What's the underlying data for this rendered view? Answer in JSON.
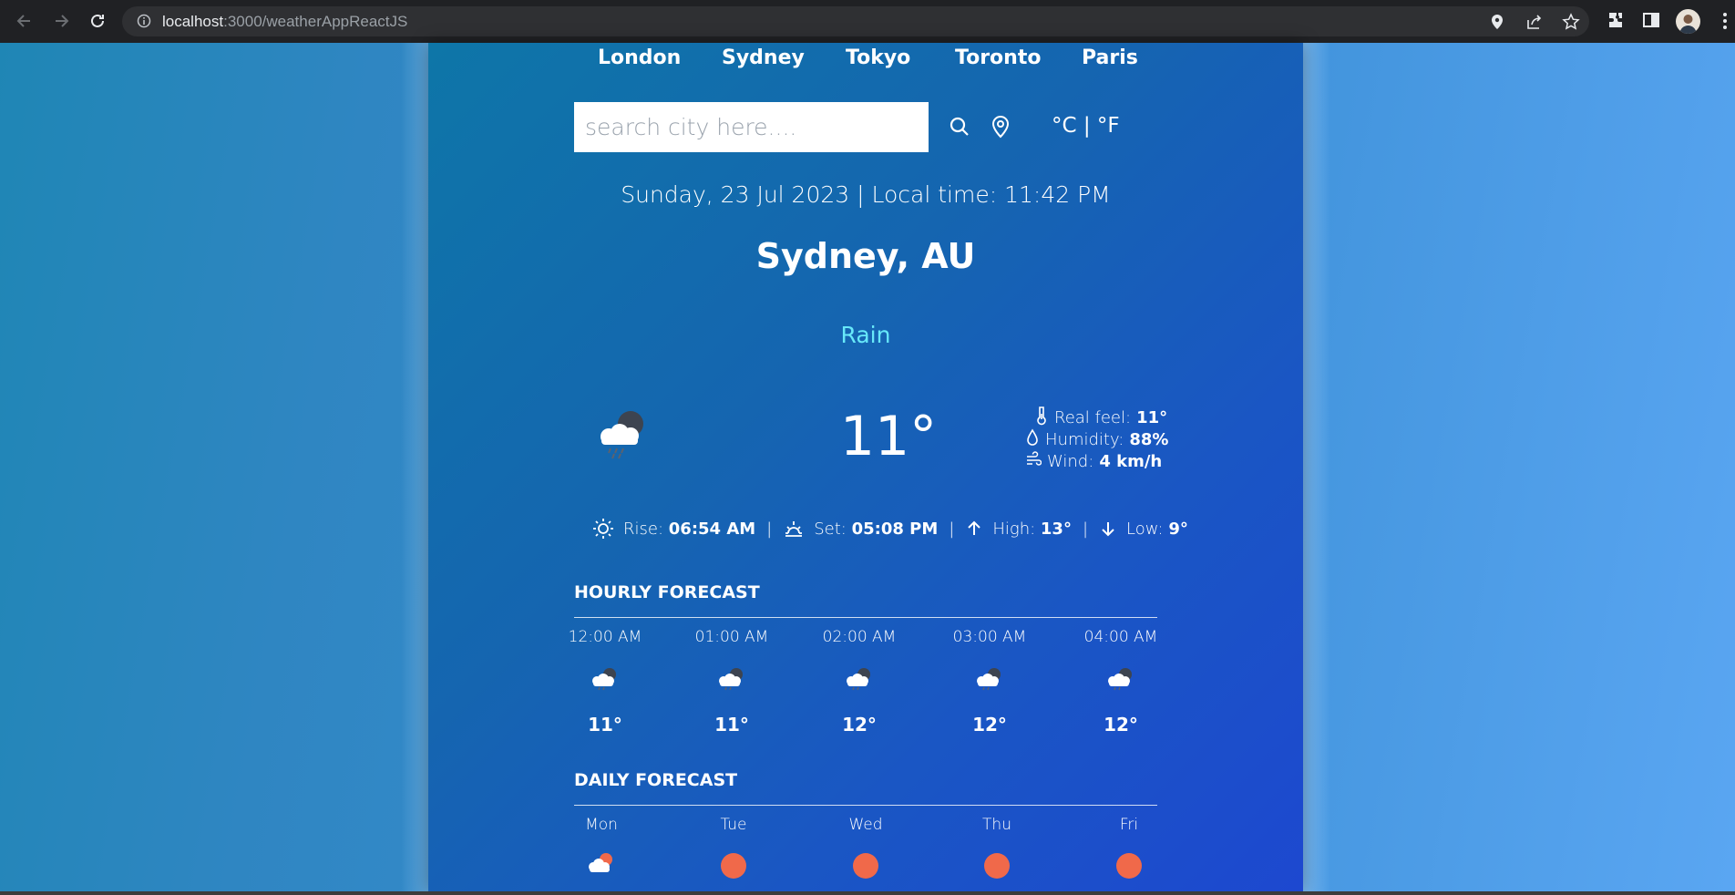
{
  "browser": {
    "url_host": "localhost",
    "url_path": ":3000/weatherAppReactJS"
  },
  "cities": [
    "London",
    "Sydney",
    "Tokyo",
    "Toronto",
    "Paris"
  ],
  "search": {
    "placeholder": "search city here...."
  },
  "units": {
    "label": "°C | °F"
  },
  "datetime": "Sunday, 23 Jul 2023 | Local time: 11:42 PM",
  "location": "Sydney, AU",
  "condition": "Rain",
  "temperature": "11°",
  "details": {
    "real_feel_label": "Real feel:",
    "real_feel": "11°",
    "humidity_label": "Humidity:",
    "humidity": "88%",
    "wind_label": "Wind:",
    "wind": "4 km/h"
  },
  "sun": {
    "rise_label": "Rise:",
    "rise": "06:54 AM",
    "set_label": "Set:",
    "set": "05:08 PM",
    "high_label": "High:",
    "high": "13°",
    "low_label": "Low:",
    "low": "9°",
    "separator": "|"
  },
  "hourly": {
    "title": "HOURLY FORECAST",
    "items": [
      {
        "time": "12:00 AM",
        "temp": "11°",
        "icon": "rain-cloud-icon"
      },
      {
        "time": "01:00 AM",
        "temp": "11°",
        "icon": "rain-cloud-icon"
      },
      {
        "time": "02:00 AM",
        "temp": "12°",
        "icon": "rain-cloud-icon"
      },
      {
        "time": "03:00 AM",
        "temp": "12°",
        "icon": "rain-cloud-icon"
      },
      {
        "time": "04:00 AM",
        "temp": "12°",
        "icon": "rain-cloud-icon"
      }
    ]
  },
  "daily": {
    "title": "DAILY FORECAST",
    "items": [
      {
        "day": "Mon",
        "icon": "cloud-sun-icon"
      },
      {
        "day": "Tue",
        "icon": "sun-icon"
      },
      {
        "day": "Wed",
        "icon": "sun-icon"
      },
      {
        "day": "Thu",
        "icon": "sun-icon"
      },
      {
        "day": "Fri",
        "icon": "sun-icon"
      }
    ]
  },
  "colors": {
    "condition": "#67e8f9",
    "sun_dot": "#f0694a"
  }
}
